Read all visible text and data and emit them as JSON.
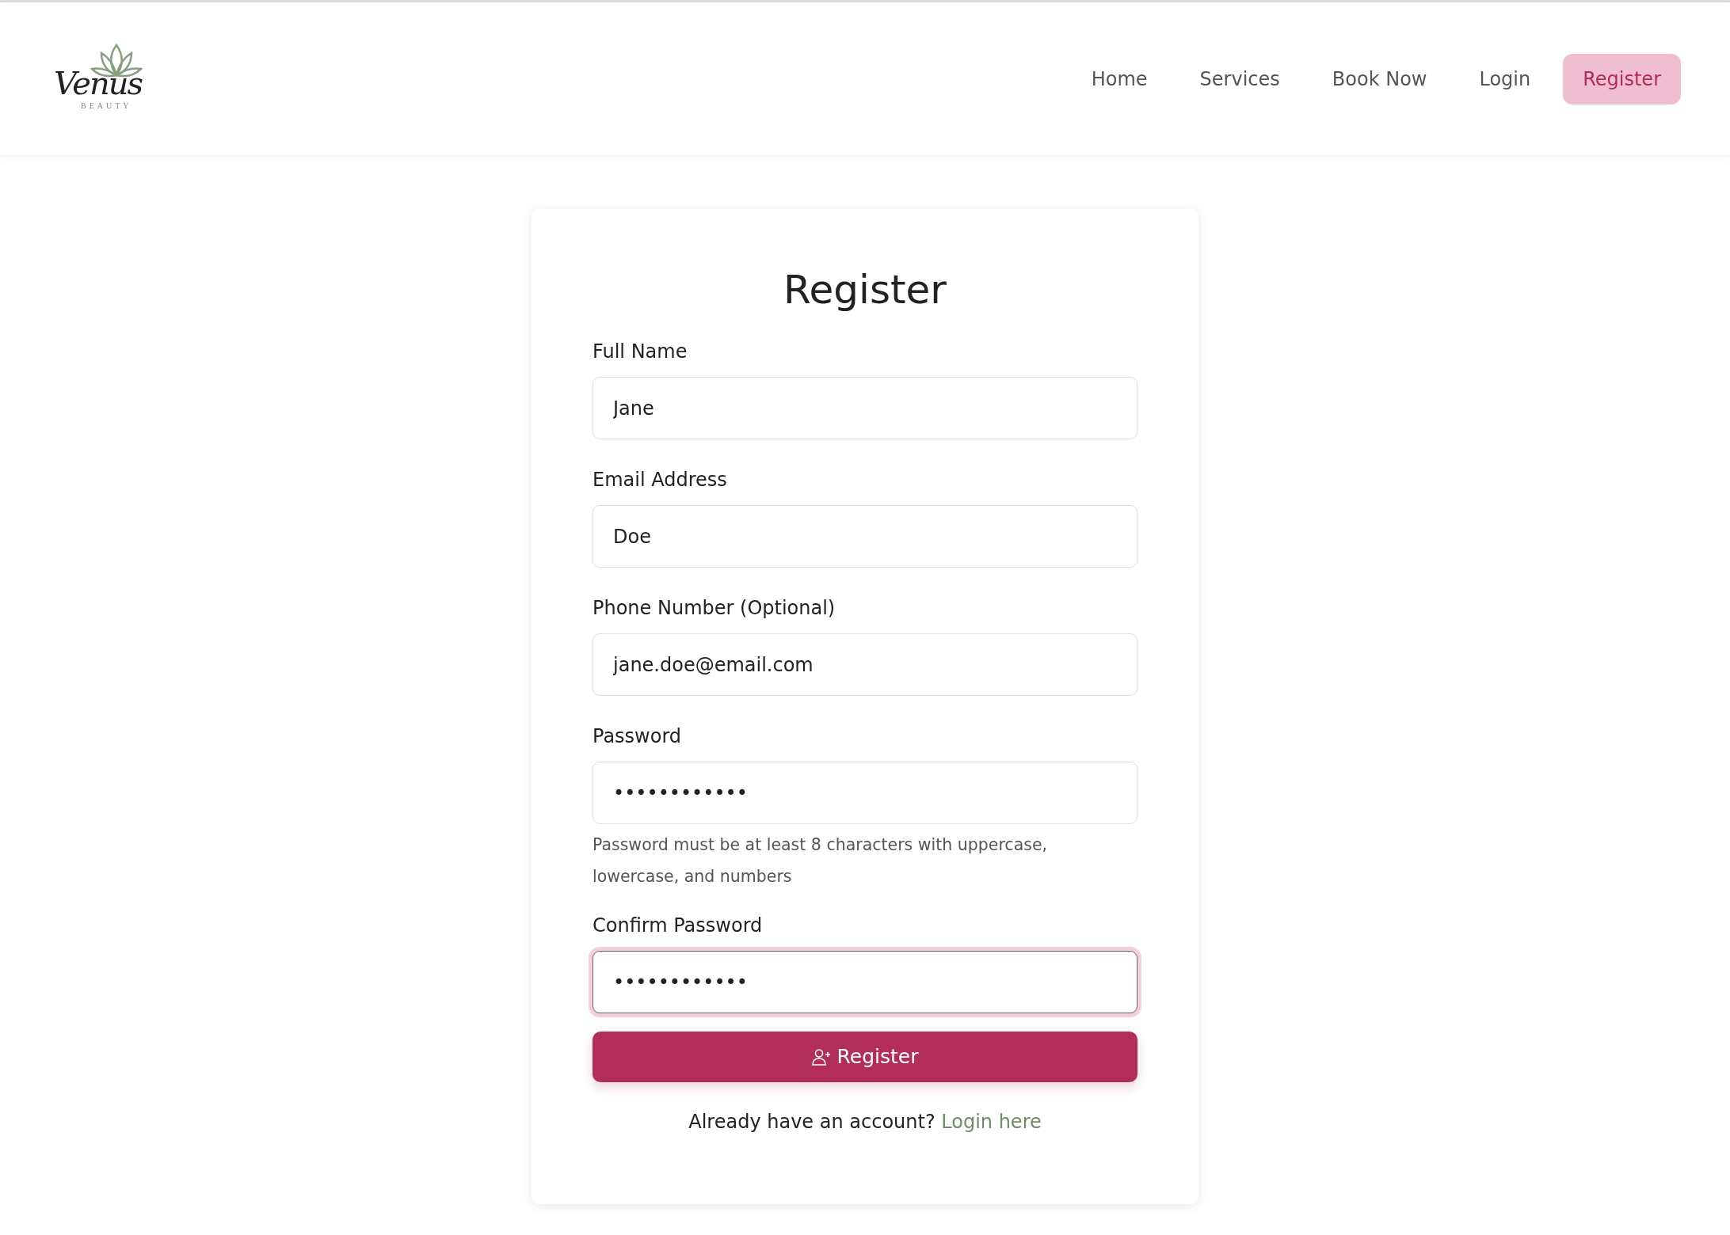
{
  "logo": {
    "script": "Venus",
    "subtitle": "BEAUTY"
  },
  "nav": [
    {
      "label": "Home",
      "selected": false
    },
    {
      "label": "Services",
      "selected": false
    },
    {
      "label": "Book Now",
      "selected": false
    },
    {
      "label": "Login",
      "selected": false
    },
    {
      "label": "Register",
      "selected": true
    }
  ],
  "form": {
    "title": "Register",
    "fields": [
      {
        "label": "Full Name",
        "value": "Jane",
        "focused": false
      },
      {
        "label": "Email Address",
        "value": "Doe",
        "focused": false
      },
      {
        "label": "Phone Number (Optional)",
        "value": "jane.doe@email.com",
        "focused": false
      },
      {
        "label": "Password",
        "value": "••••••••••••",
        "focused": false,
        "help": "Password must be at least 8 characters with uppercase, lowercase, and numbers"
      },
      {
        "label": "Confirm Password",
        "value": "••••••••••••",
        "focused": true
      }
    ],
    "submit": "Register",
    "footer_text": "Already have an account?",
    "footer_link": "Login here"
  }
}
